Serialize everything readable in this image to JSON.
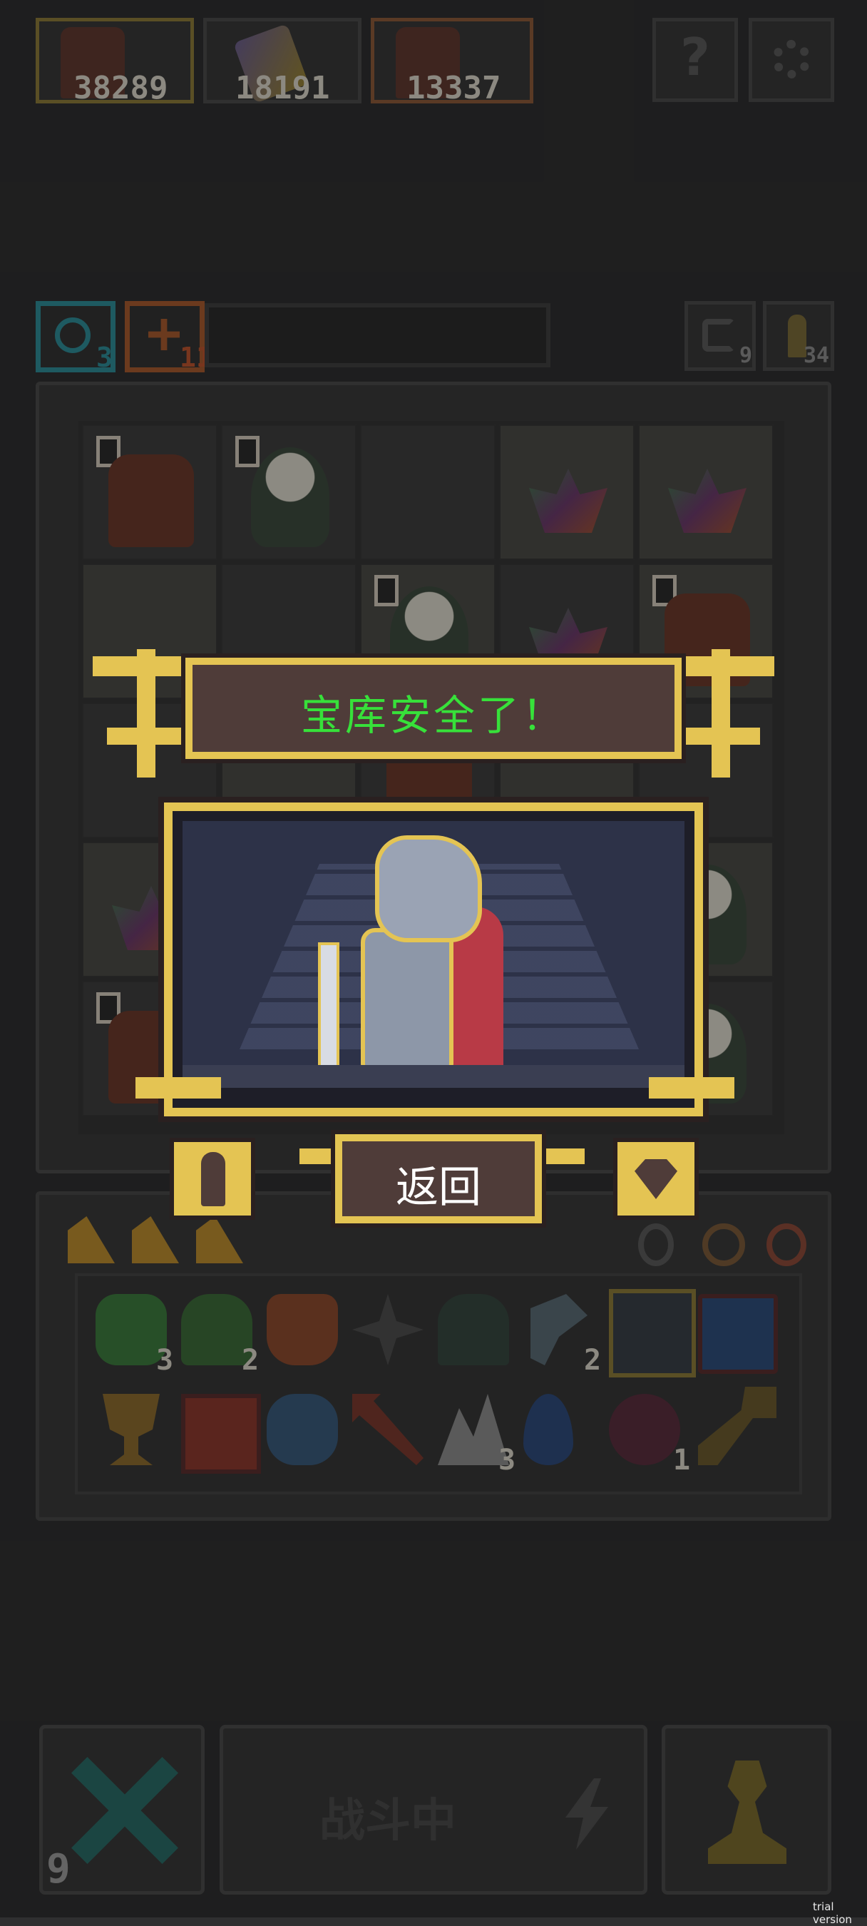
{
  "resources": {
    "res1": {
      "value": "38289",
      "icon": "dragon-icon"
    },
    "res2": {
      "value": "18191",
      "icon": "magic-key-icon"
    },
    "res3": {
      "value": "13337",
      "icon": "dragon-icon"
    }
  },
  "top_buttons": {
    "help_label": "?",
    "settings_icon": "gear-icon"
  },
  "status": {
    "shield_count": "3",
    "sword_count": "11",
    "undo_count": "9",
    "key_count": "34"
  },
  "popup": {
    "title": "宝库安全了！",
    "back_label": "返回",
    "title_color": "#37e13a",
    "frame_color": "#e4c453",
    "banner_color": "#4f3c39"
  },
  "inventory": {
    "row1": [
      {
        "icon": "emerald-gem-icon",
        "count": "3"
      },
      {
        "icon": "goblin-icon",
        "count": "2"
      },
      {
        "icon": "armor-icon",
        "count": ""
      },
      {
        "icon": "shuriken-icon",
        "count": ""
      },
      {
        "icon": "bell-icon",
        "count": ""
      },
      {
        "icon": "axe-icon",
        "count": "2"
      },
      {
        "icon": "crown-spikes-icon",
        "count": ""
      },
      {
        "icon": "blue-flame-icon",
        "count": ""
      }
    ],
    "row2": [
      {
        "icon": "trophy-icon",
        "count": ""
      },
      {
        "icon": "fire-scroll-icon",
        "count": ""
      },
      {
        "icon": "blue-beast-icon",
        "count": ""
      },
      {
        "icon": "arrow-icon",
        "count": ""
      },
      {
        "icon": "wings-icon",
        "count": "3"
      },
      {
        "icon": "water-drop-icon",
        "count": ""
      },
      {
        "icon": "demon-mask-icon",
        "count": "1"
      },
      {
        "icon": "golden-key-icon",
        "count": ""
      }
    ]
  },
  "bottom": {
    "cancel_count": "9",
    "battle_label": "战斗中",
    "pawn_icon": "pawn-icon"
  },
  "watermark": "trial version"
}
